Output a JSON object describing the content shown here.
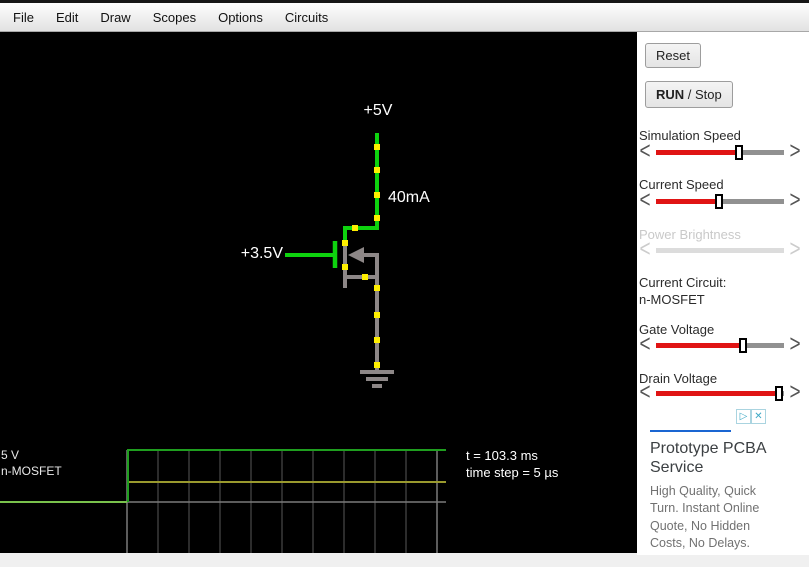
{
  "menu": {
    "items": [
      "File",
      "Edit",
      "Draw",
      "Scopes",
      "Options",
      "Circuits"
    ]
  },
  "sidebar": {
    "reset_label": "Reset",
    "run_label": "RUN",
    "run_suffix": " / Stop",
    "sliders": [
      {
        "label": "Simulation Speed",
        "value_pct": 66,
        "disabled": false
      },
      {
        "label": "Current Speed",
        "value_pct": 50,
        "disabled": false
      },
      {
        "label": "Power Brightness",
        "value_pct": 0,
        "disabled": true
      },
      {
        "label": "Gate Voltage",
        "value_pct": 69,
        "disabled": false
      },
      {
        "label": "Drain Voltage",
        "value_pct": 97,
        "disabled": false
      }
    ],
    "current_circuit_label": "Current Circuit:",
    "current_circuit_name": "n-MOSFET",
    "accent_red": "#e01414"
  },
  "circuit": {
    "supply_label": "+5V",
    "current_label": "40mA",
    "gate_label": "+3.5V",
    "wire_green": "#0ed30e",
    "wire_gray": "#8d8787",
    "current_dot_yellow": "#ffee00"
  },
  "scope": {
    "left_label_value": "5 V",
    "left_label_name": "n-MOSFET",
    "time_text": "t = 103.3 ms",
    "timestep_text": "time step = 5 µs",
    "trace_green": "#1f9e1f",
    "trace_green_low": "#79c24c",
    "trace_yellow": "#9a9a2e"
  },
  "ad": {
    "choices_icon_label": "▷",
    "close_icon_label": "✕",
    "title": "Prototype PCBA Service",
    "body": "High Quality, Quick Turn. Instant Online Quote, No Hidden Costs, No Delays."
  }
}
